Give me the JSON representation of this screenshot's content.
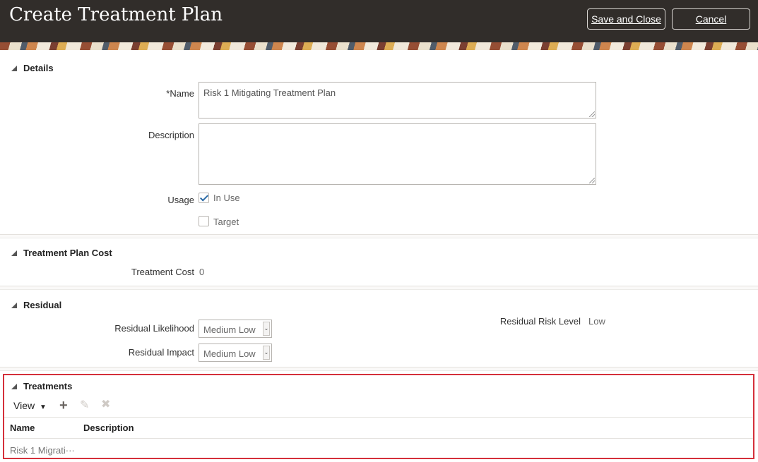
{
  "header": {
    "title": "Create Treatment Plan",
    "save_close_label": "Save and Close",
    "cancel_label": "Cancel"
  },
  "details": {
    "heading": "Details",
    "name_required_marker": "*",
    "name_label": "Name",
    "name_value": "Risk 1 Mitigating Treatment Plan",
    "description_label": "Description",
    "description_value": "",
    "usage_label": "Usage",
    "in_use_label": "In Use",
    "in_use_checked": true,
    "target_label": "Target",
    "target_checked": false
  },
  "cost": {
    "heading": "Treatment Plan Cost",
    "treatment_cost_label": "Treatment Cost",
    "treatment_cost_value": "0"
  },
  "residual": {
    "heading": "Residual",
    "likelihood_label": "Residual Likelihood",
    "likelihood_value": "Medium Low",
    "impact_label": "Residual Impact",
    "impact_value": "Medium Low",
    "risk_level_label": "Residual Risk Level",
    "risk_level_value": "Low"
  },
  "treatments": {
    "heading": "Treatments",
    "view_label": "View",
    "icons": [
      "add-icon",
      "edit-icon",
      "delete-icon"
    ],
    "columns": [
      "Name",
      "Description"
    ],
    "rows": [
      {
        "name": "Risk 1 Migrati···",
        "description": ""
      }
    ]
  },
  "colors": {
    "header_bg": "#312d2a",
    "highlight_border": "#d4303a",
    "checkbox_accent": "#2a69a6"
  }
}
